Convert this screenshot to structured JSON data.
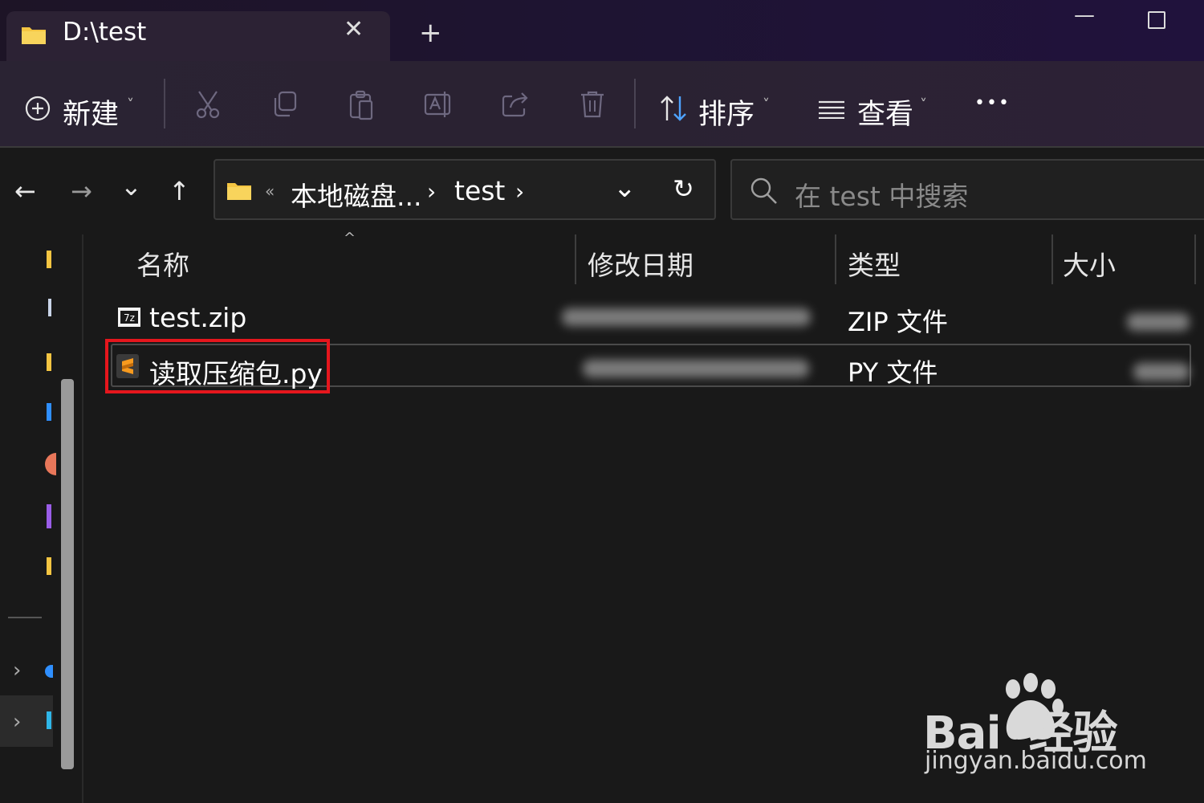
{
  "tab": {
    "title": "D:\\test",
    "close_glyph": "✕",
    "new_tab_glyph": "+"
  },
  "window": {
    "minimize_glyph": "—"
  },
  "toolbar": {
    "new_label": "新建",
    "sort_label": "排序",
    "view_label": "查看",
    "caret": "˅",
    "more_glyph": "•••"
  },
  "icons": [
    "plus-circle-icon",
    "cut-icon",
    "copy-icon",
    "paste-icon",
    "rename-icon",
    "share-icon",
    "delete-icon",
    "sort-icon",
    "view-icon",
    "folder-icon",
    "search-icon",
    "refresh-icon",
    "zip-file-icon",
    "python-file-icon"
  ],
  "nav": {
    "back": "←",
    "forward": "→",
    "recent": "⌄",
    "up": "↑",
    "chevron": "›"
  },
  "address": {
    "overflow": "«",
    "segments": [
      "本地磁盘...",
      "test"
    ],
    "sep": "›",
    "dropdown": "⌄",
    "refresh": "↻"
  },
  "search": {
    "placeholder": "在 test 中搜索"
  },
  "columns": {
    "name": "名称",
    "modified": "修改日期",
    "type": "类型",
    "size": "大小",
    "sort_glyph": "^"
  },
  "files": [
    {
      "name": "test.zip",
      "type": "ZIP 文件"
    },
    {
      "name": "读取压缩包.py",
      "type": "PY 文件"
    }
  ],
  "colors": {
    "highlight": "#e5161d",
    "folder": "#f4c542",
    "sublime": "#f79a1e",
    "accent": "#4ea3ff"
  },
  "watermark": {
    "brand": "Bai◦经验",
    "url": "jingyan.baidu.com"
  }
}
